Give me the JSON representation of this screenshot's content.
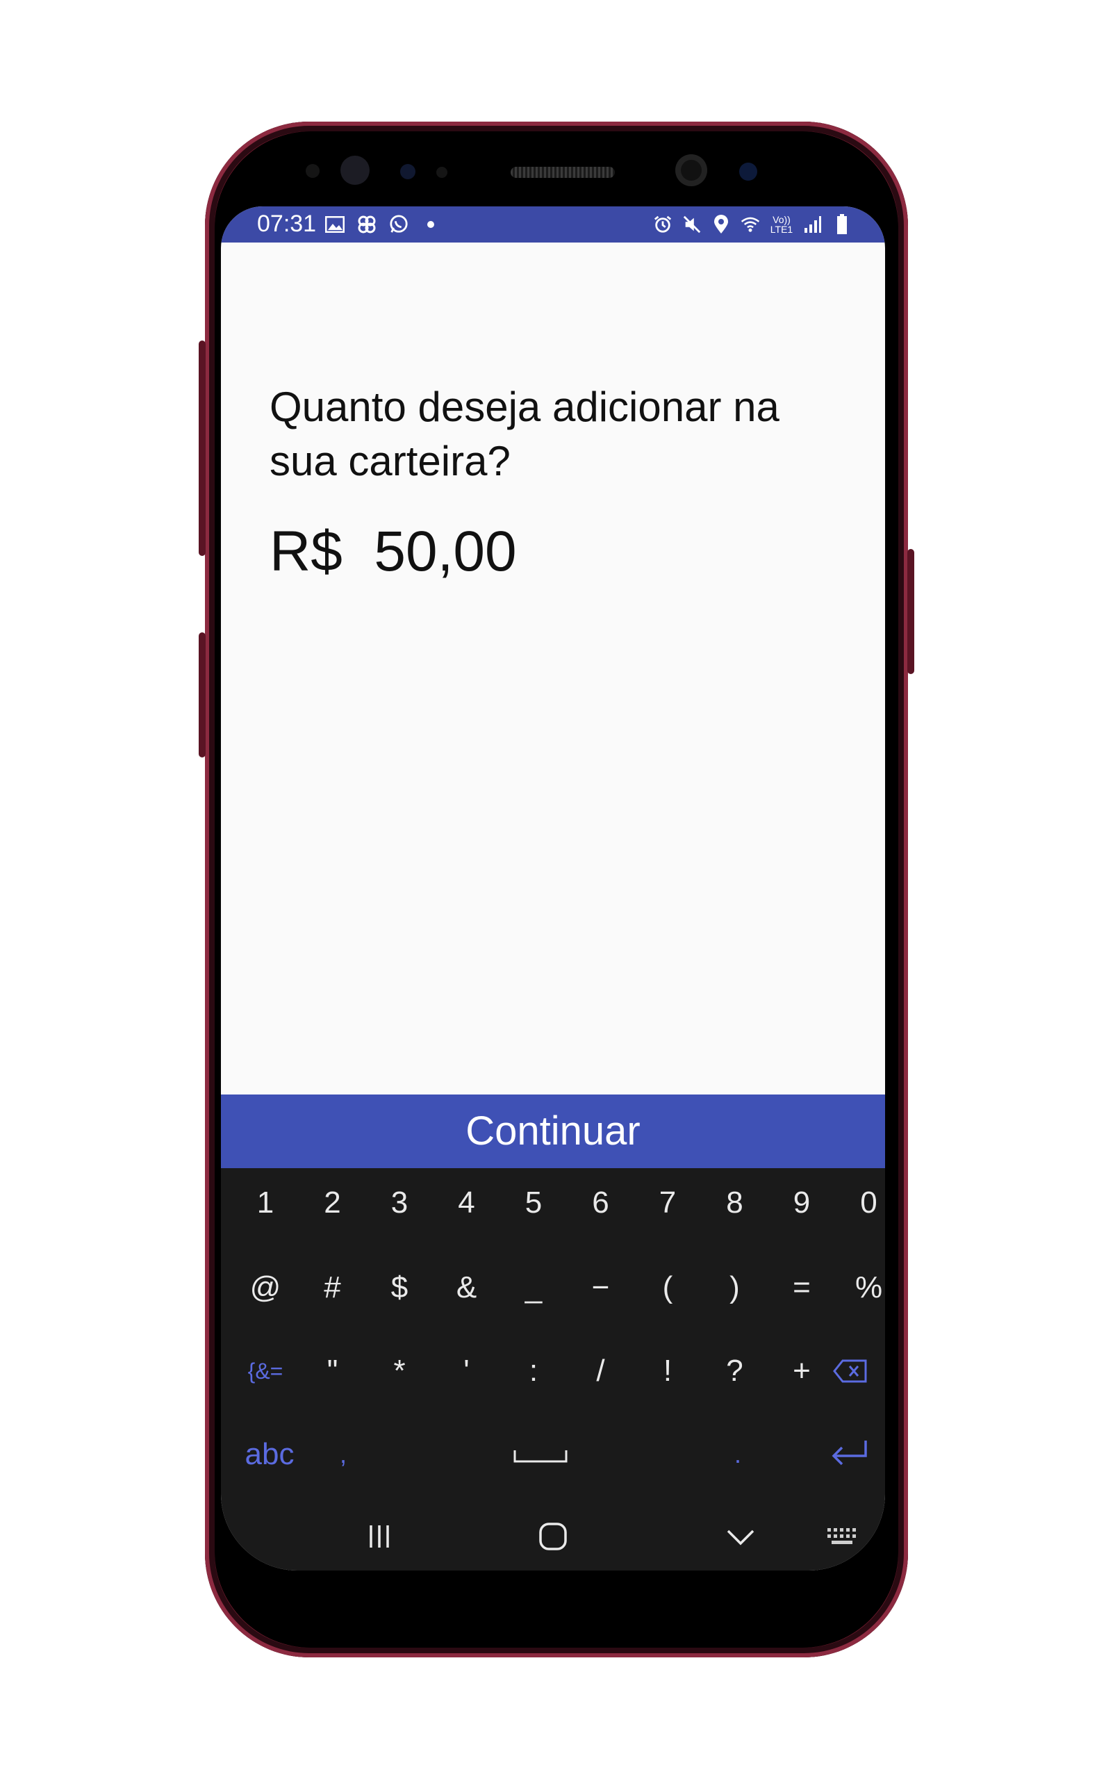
{
  "status_bar": {
    "time": "07:31",
    "left_icons": [
      "image-icon",
      "pinwheel-icon",
      "whatsapp-icon",
      "dot-icon"
    ],
    "right_icons": [
      "alarm-icon",
      "mute-icon",
      "location-icon",
      "wifi-icon",
      "volte-icon",
      "signal-icon",
      "battery-icon"
    ],
    "volte_text": "Vo)) LTE1",
    "color": "#3c4aa6"
  },
  "screen": {
    "question": " Quanto deseja adicionar na sua carteira?",
    "currency": "R$",
    "amount": "50,00",
    "continue_label": "Continuar",
    "button_color": "#3f51b5"
  },
  "keyboard": {
    "row1": [
      "1",
      "2",
      "3",
      "4",
      "5",
      "6",
      "7",
      "8",
      "9",
      "0"
    ],
    "row2": [
      "@",
      "#",
      "$",
      "&",
      "_",
      "−",
      "(",
      ")",
      "=",
      "%"
    ],
    "row3": [
      "{&=",
      "\"",
      "*",
      "'",
      ":",
      "/",
      "!",
      "?",
      "+"
    ],
    "abc_label": "abc",
    "comma": ",",
    "period": ".",
    "accent_color": "#5b6be0"
  },
  "nav": {
    "icons": [
      "recent-apps-icon",
      "home-icon",
      "hide-keyboard-icon",
      "keyboard-switch-icon"
    ]
  }
}
